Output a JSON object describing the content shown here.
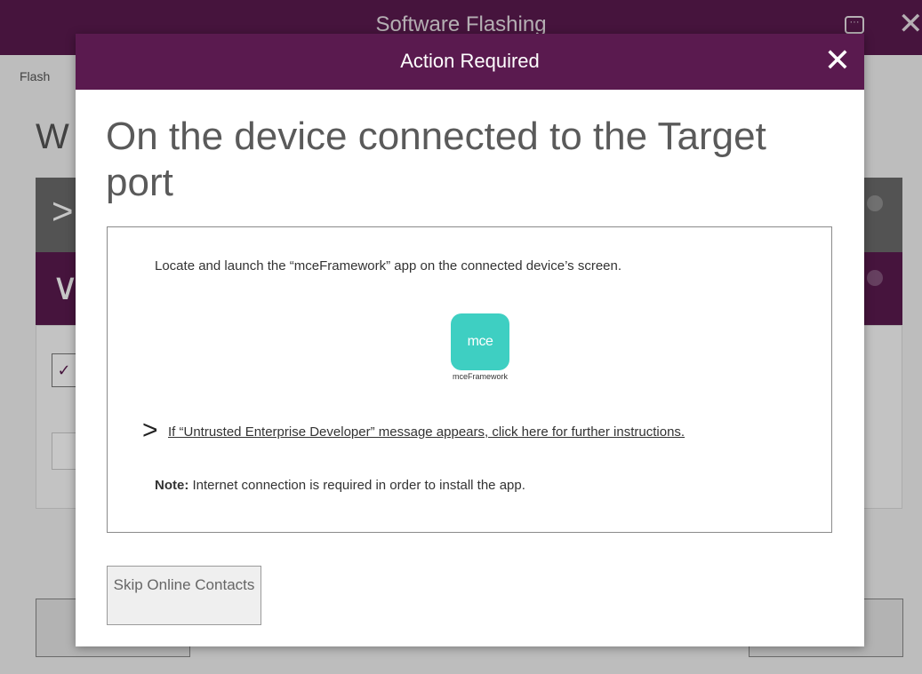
{
  "window": {
    "title": "Software Flashing",
    "breadcrumb": "Flash",
    "page_title_partial": "W"
  },
  "dialog": {
    "title": "Action Required",
    "heading": "On the device connected to the Target port",
    "instruction": "Locate and launch the “mceFramework” app on the connected device’s screen.",
    "app_icon_text": "mce",
    "app_icon_label": "mceFramework",
    "expand_link": "If “Untrusted Enterprise Developer” message appears, click here for further instructions.",
    "note_label": "Note:",
    "note_text": " Internet connection is required in order to install the app.",
    "skip_button": "Skip Online Contacts"
  },
  "colors": {
    "brand_purple": "#5a1a4f",
    "app_icon_teal": "#3ecfc2"
  },
  "icons": {
    "window_close": "close-icon",
    "window_chat": "chat-icon",
    "dialog_close": "close-icon",
    "expand": "chevron-right-icon"
  }
}
